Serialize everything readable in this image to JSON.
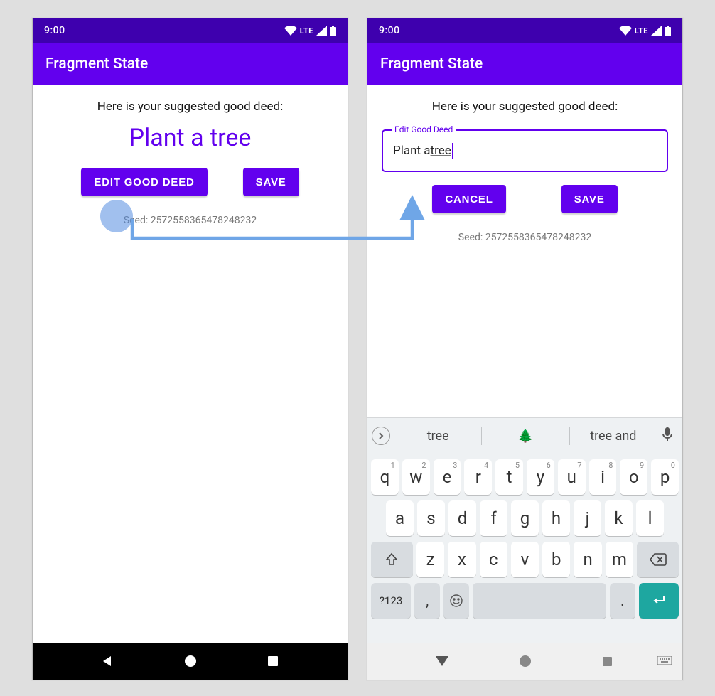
{
  "status": {
    "time": "9:00",
    "lte": "LTE"
  },
  "app": {
    "title": "Fragment State"
  },
  "screen1": {
    "suggest": "Here is your suggested good deed:",
    "deed": "Plant a tree",
    "edit_label": "EDIT GOOD DEED",
    "save_label": "SAVE",
    "seed": "Seed: 2572558365478248232"
  },
  "screen2": {
    "suggest": "Here is your suggested good deed:",
    "field_label": "Edit Good Deed",
    "field_value_pre": "Plant a ",
    "field_value_under": "tree",
    "cancel_label": "CANCEL",
    "save_label": "SAVE",
    "seed": "Seed: 2572558365478248232"
  },
  "keyboard": {
    "sugg1": "tree",
    "sugg2": "🌲",
    "sugg3": "tree and",
    "row1": [
      "q",
      "w",
      "e",
      "r",
      "t",
      "y",
      "u",
      "i",
      "o",
      "p"
    ],
    "digits": [
      "1",
      "2",
      "3",
      "4",
      "5",
      "6",
      "7",
      "8",
      "9",
      "0"
    ],
    "row2": [
      "a",
      "s",
      "d",
      "f",
      "g",
      "h",
      "j",
      "k",
      "l"
    ],
    "row3": [
      "z",
      "x",
      "c",
      "v",
      "b",
      "n",
      "m"
    ],
    "symbols": "?123",
    "comma": ",",
    "period": "."
  }
}
